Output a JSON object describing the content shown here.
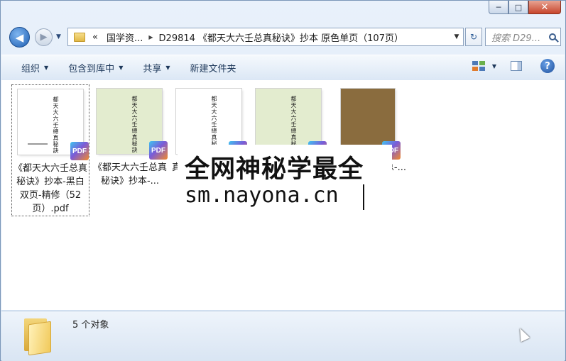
{
  "window": {
    "controls": {
      "minimize": "─",
      "maximize": "□",
      "close": "✕"
    }
  },
  "nav": {
    "back_glyph": "◀",
    "forward_glyph": "▶",
    "history_drop": "▼",
    "address": {
      "overflow": "«",
      "segments": [
        "国学资...",
        "D29814 《都天大六壬总真秘诀》抄本 原色单页（107页）"
      ],
      "separator": "▶",
      "drop": "▼"
    },
    "refresh_glyph": "↻",
    "search_placeholder": "搜索 D29..."
  },
  "toolbar": {
    "items": [
      "组织",
      "包含到库中",
      "共享",
      "新建文件夹"
    ],
    "caret": "▼",
    "help": "?"
  },
  "files": [
    {
      "label": "《都天大六壬总真秘诀》抄本-黑白双页-精修（52页）.pdf",
      "thumb_bg": "#ffffff",
      "selected": true,
      "badge": "PDF",
      "thumb_text": "都天大六壬總真秘訣"
    },
    {
      "label": "《都天大六壬总真秘诀》抄本-...",
      "thumb_bg": "#e3eccf",
      "selected": false,
      "badge": "PDF",
      "thumb_text": "都天大六壬總真秘訣"
    },
    {
      "label": "真",
      "thumb_bg": "#ffffff",
      "selected": false,
      "badge": "PDF",
      "thumb_text": "都天大六壬總真秘訣"
    },
    {
      "label": "",
      "thumb_bg": "#e3eccf",
      "selected": false,
      "badge": "PDF",
      "thumb_text": "都天大六壬總真秘訣"
    },
    {
      "label": "E总-...",
      "thumb_bg": "#8a6c3e",
      "selected": false,
      "badge": "PDF",
      "thumb_text": ""
    }
  ],
  "watermark": {
    "line1": "全网神秘学最全",
    "line2": "sm.nayona.cn"
  },
  "status": {
    "count_text": "5 个对象"
  }
}
